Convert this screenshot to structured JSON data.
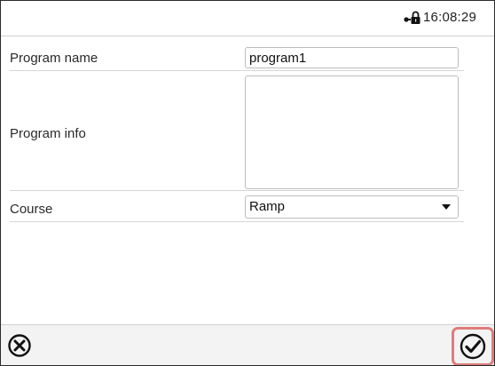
{
  "status_bar": {
    "lock_icon": "lock-icon",
    "time": "16:08:29"
  },
  "form": {
    "program_name": {
      "label": "Program name",
      "value": "program1"
    },
    "program_info": {
      "label": "Program info",
      "value": ""
    },
    "course": {
      "label": "Course",
      "value": "Ramp"
    }
  },
  "footer": {
    "cancel_icon": "cancel-circle-x-icon",
    "confirm_icon": "confirm-circle-check-icon"
  },
  "colors": {
    "highlight_border": "#e07b7b",
    "footer_bg": "#f3f3f3",
    "divider": "#d6d6d6"
  }
}
